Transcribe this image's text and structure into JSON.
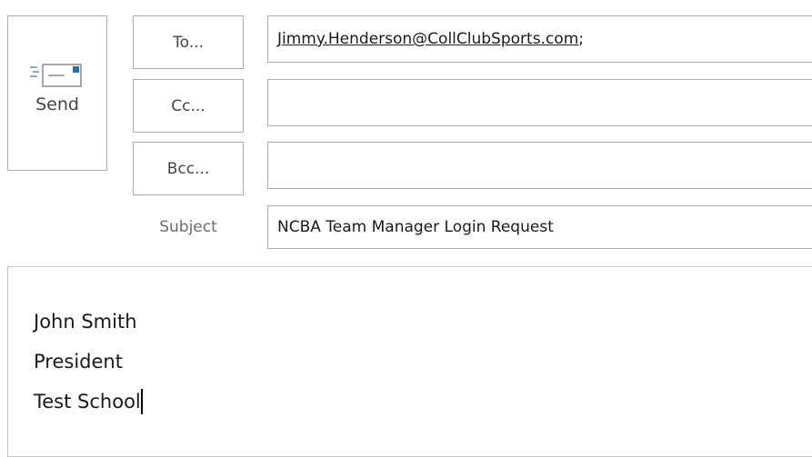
{
  "send": {
    "label": "Send",
    "icon": "send-envelope-icon"
  },
  "fields": {
    "to_button": "To...",
    "cc_button": "Cc...",
    "bcc_button": "Bcc...",
    "subject_label": "Subject"
  },
  "values": {
    "to": "Jimmy.Henderson@CollClubSports.com",
    "to_separator": ";",
    "cc": "",
    "bcc": "",
    "subject": "NCBA Team Manager Login Request"
  },
  "body": {
    "lines": [
      "John Smith",
      "President",
      "Test School"
    ]
  },
  "colors": {
    "border": "#ababab",
    "icon_accent": "#2b6cb0",
    "text": "#1a1a1a",
    "muted_label": "#6b6b6b"
  }
}
